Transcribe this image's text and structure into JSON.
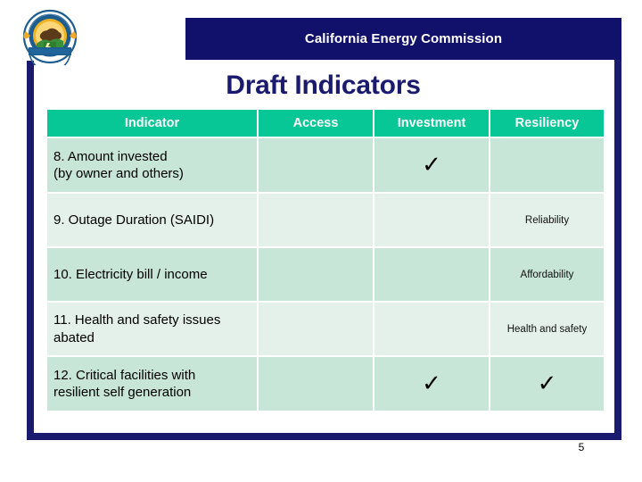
{
  "header": {
    "org_name": "California Energy Commission",
    "logo_alt": "california-energy-commission-seal"
  },
  "slide": {
    "title": "Draft Indicators",
    "page_number": "5"
  },
  "table": {
    "columns": [
      "Indicator",
      "Access",
      "Investment",
      "Resiliency"
    ],
    "check_glyph": "✓",
    "rows": [
      {
        "indicator_line1": "8. Amount invested",
        "indicator_line2": "(by owner and others)",
        "access": "",
        "investment": "✓",
        "resiliency": ""
      },
      {
        "indicator_line1": "9. Outage Duration (SAIDI)",
        "indicator_line2": "",
        "access": "",
        "investment": "",
        "resiliency": "Reliability"
      },
      {
        "indicator_line1": "10. Electricity bill / income",
        "indicator_line2": "",
        "access": "",
        "investment": "",
        "resiliency": "Affordability"
      },
      {
        "indicator_line1": "11. Health and safety issues",
        "indicator_line2": "abated",
        "access": "",
        "investment": "",
        "resiliency": "Health and safety"
      },
      {
        "indicator_line1": "12. Critical facilities with",
        "indicator_line2": "resilient self generation",
        "access": "",
        "investment": "✓",
        "resiliency": "✓"
      }
    ]
  },
  "colors": {
    "navy": "#1a1a6e",
    "banner_navy": "#11116b",
    "header_teal": "#06c795",
    "row_dark": "#c8e6d8",
    "row_light": "#e3f1ea"
  }
}
